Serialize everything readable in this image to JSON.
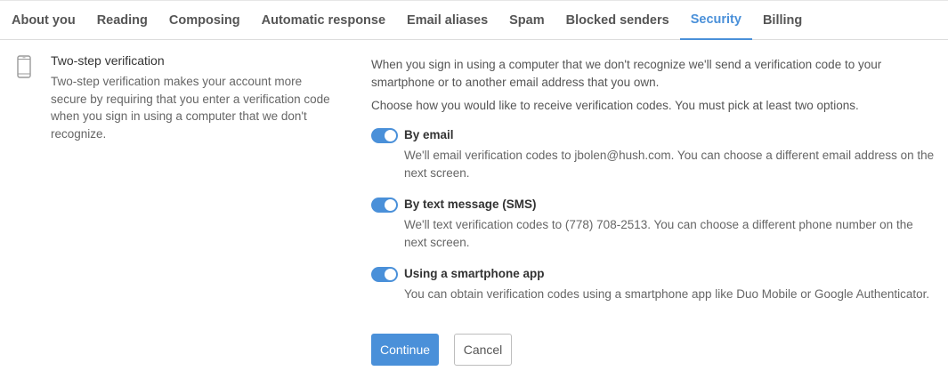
{
  "tabs": [
    {
      "label": "About you"
    },
    {
      "label": "Reading"
    },
    {
      "label": "Composing"
    },
    {
      "label": "Automatic response"
    },
    {
      "label": "Email aliases"
    },
    {
      "label": "Spam"
    },
    {
      "label": "Blocked senders"
    },
    {
      "label": "Security"
    },
    {
      "label": "Billing"
    }
  ],
  "active_tab": "Security",
  "section": {
    "icon": "smartphone-icon",
    "title": "Two-step verification",
    "description": "Two-step verification makes your account more secure by requiring that you enter a verification code when you sign in using a computer that we don't recognize."
  },
  "main": {
    "intro": "When you sign in using a computer that we don't recognize we'll send a verification code to your smartphone or to another email address that you own.",
    "choose": "Choose how you would like to receive verification codes. You must pick at least two options.",
    "options": [
      {
        "title": "By email",
        "description": "We'll email verification codes to jbolen@hush.com. You can choose a different email address on the next screen.",
        "enabled": true
      },
      {
        "title": "By text message (SMS)",
        "description": "We'll text verification codes to (778) 708-2513. You can choose a different phone number on the next screen.",
        "enabled": true
      },
      {
        "title": "Using a smartphone app",
        "description": "You can obtain verification codes using a smartphone app like Duo Mobile or Google Authenticator.",
        "enabled": true
      }
    ],
    "continue_label": "Continue",
    "cancel_label": "Cancel"
  },
  "colors": {
    "accent": "#4a90d9",
    "text": "#333333",
    "muted": "#666666"
  }
}
